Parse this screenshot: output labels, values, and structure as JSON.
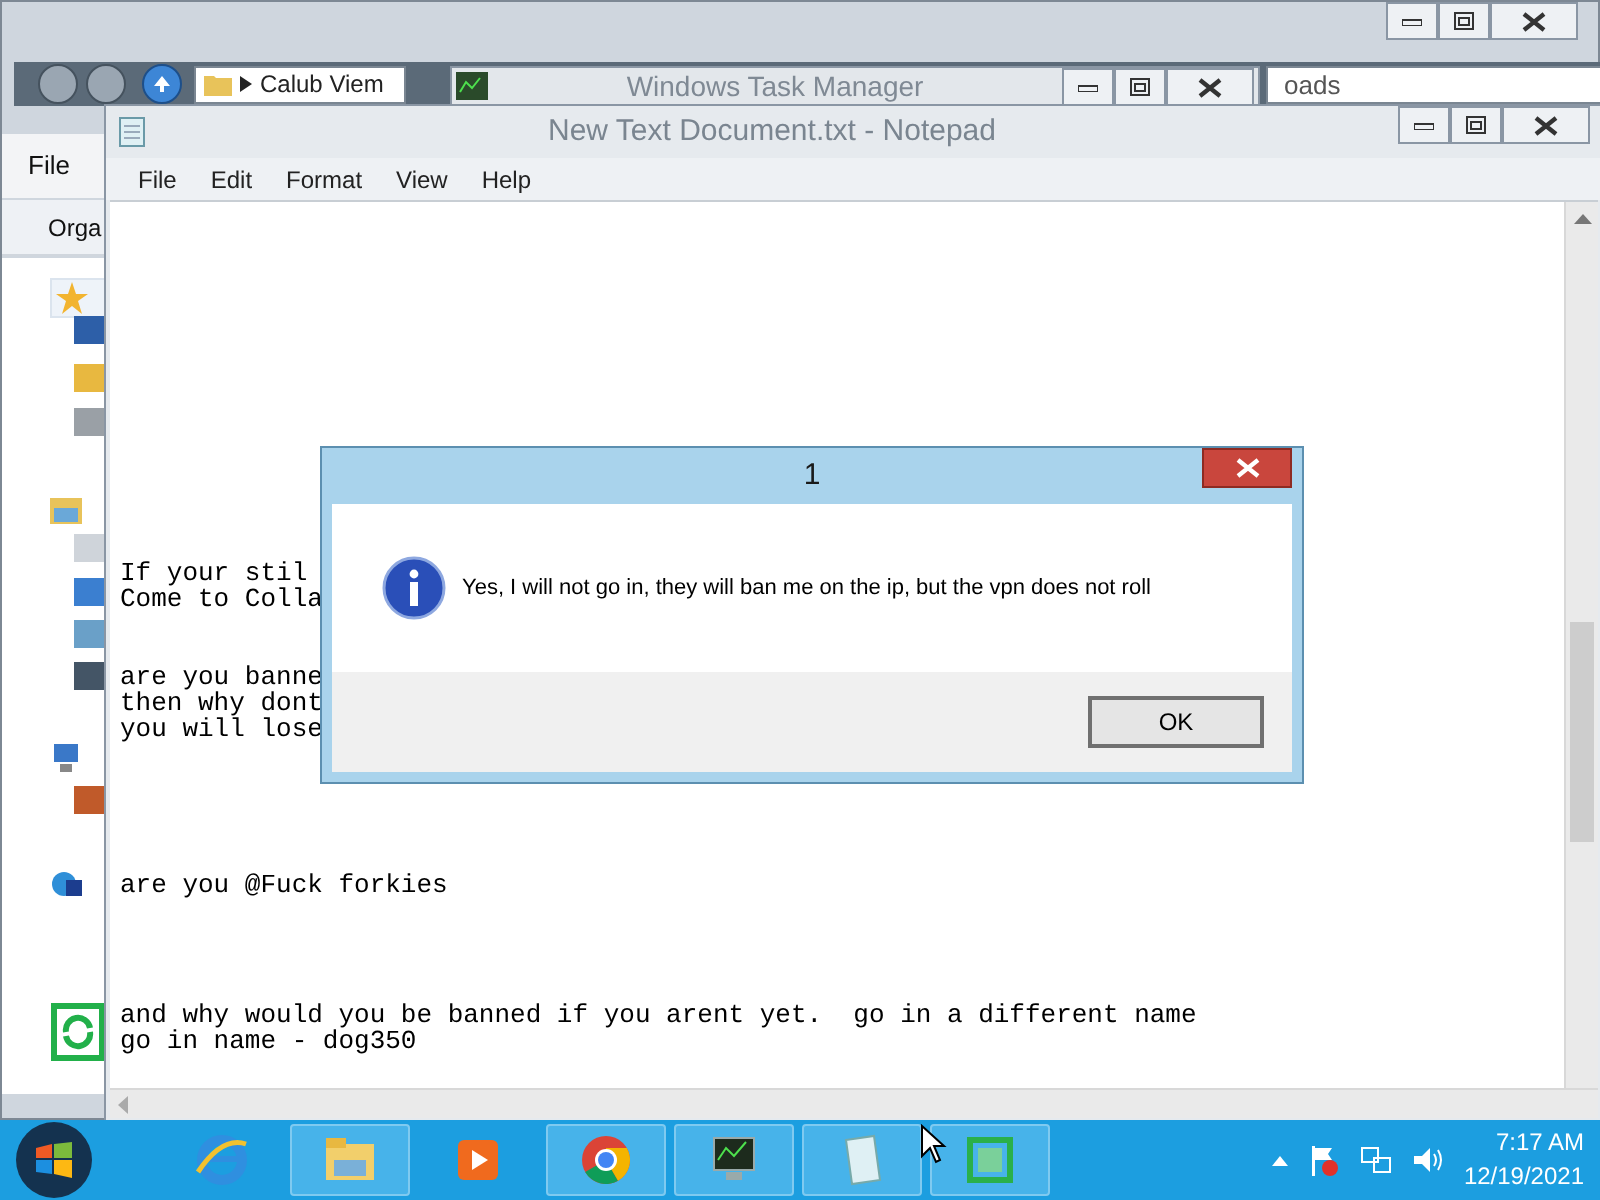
{
  "explorer": {
    "address": "Calub Viem",
    "search": "oads",
    "menu": [
      "File"
    ],
    "toolbar": [
      "Orga"
    ]
  },
  "task_manager": {
    "title": "Windows Task Manager"
  },
  "notepad": {
    "title": "New Text Document.txt - Notepad",
    "menu": [
      "File",
      "Edit",
      "Format",
      "View",
      "Help"
    ],
    "paragraphs": [
      {
        "lines": [
          "If your stil",
          "Come to Colla"
        ]
      },
      {
        "lines": [
          "are you banne",
          "then why dont",
          "you will lose"
        ]
      },
      {
        "lines": [
          "are you @Fuck forkies"
        ]
      },
      {
        "lines": [
          "and why would you be banned if you arent yet.  go in a different name",
          "go in name - dog350"
        ]
      }
    ]
  },
  "dialog": {
    "title": "1",
    "message": "Yes, I will not go in, they will ban me on the ip, but the vpn does not roll",
    "buttons": [
      "OK"
    ]
  },
  "taskbar": {
    "items": [
      {
        "running": false
      },
      {
        "running": true
      },
      {
        "running": false
      },
      {
        "running": true
      },
      {
        "running": true
      },
      {
        "running": true
      },
      {
        "running": true
      }
    ],
    "clock": {
      "time": "7:17 AM",
      "date": "12/19/2021"
    }
  }
}
